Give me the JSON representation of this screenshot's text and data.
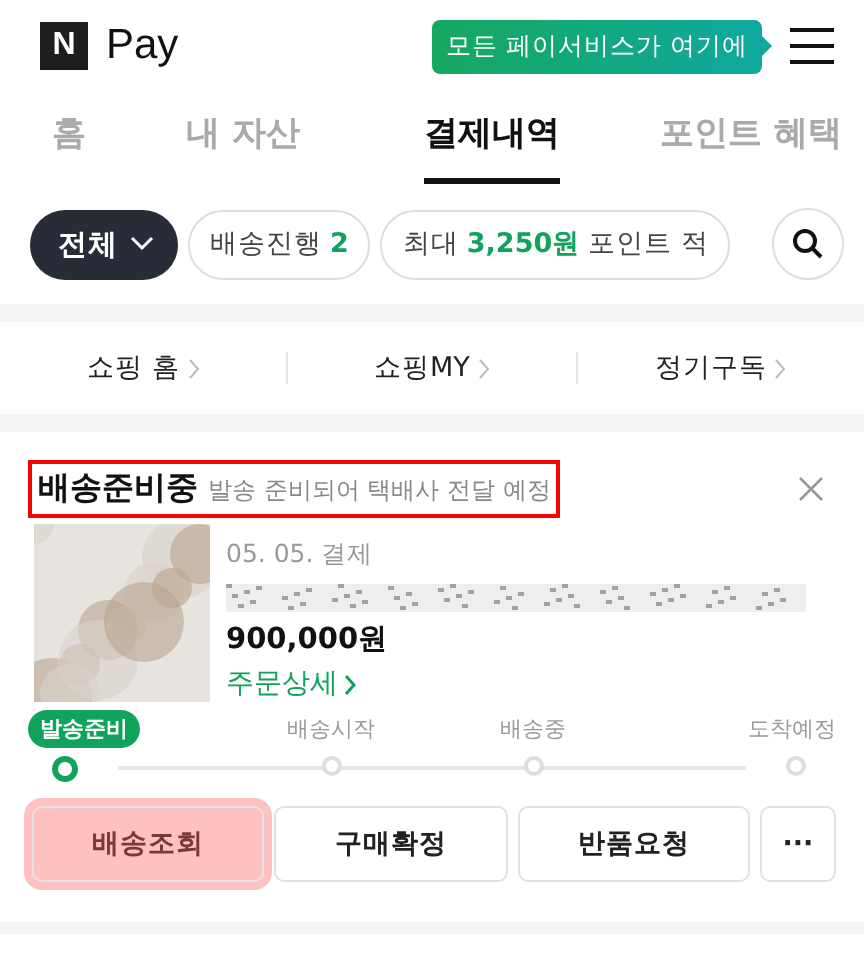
{
  "header": {
    "logo_mark": "N",
    "logo_text": "Pay",
    "tooltip": "모든 페이서비스가 여기에"
  },
  "tabs": [
    {
      "label": "홈",
      "selected": false
    },
    {
      "label": "내 자산",
      "selected": false
    },
    {
      "label": "결제내역",
      "selected": true
    },
    {
      "label": "포인트 혜택",
      "selected": false
    }
  ],
  "filters": {
    "dropdown": "전체",
    "chips": [
      {
        "label": "배송진행",
        "count": "2"
      },
      {
        "label": "최대",
        "highlight": "3,250원",
        "rest": "포인트 적"
      }
    ]
  },
  "shortcuts": [
    {
      "label": "쇼핑 홈"
    },
    {
      "label": "쇼핑MY"
    },
    {
      "label": "정기구독"
    }
  ],
  "order": {
    "status": "배송준비중",
    "status_note": "발송 준비되어 택배사 전달 예정",
    "outlined": true,
    "date": "05. 05. 결제",
    "price": "900,000원",
    "detail_link": "주문상세",
    "steps": [
      {
        "label": "발송준비",
        "selected": true
      },
      {
        "label": "배송시작",
        "selected": false
      },
      {
        "label": "배송중",
        "selected": false
      },
      {
        "label": "도착예정",
        "selected": false
      }
    ],
    "buttons": [
      {
        "label": "배송조회",
        "highlighted": true
      },
      {
        "label": "구매확정",
        "highlighted": false
      },
      {
        "label": "반품요청",
        "highlighted": false
      },
      {
        "label": "···",
        "highlighted": false
      }
    ]
  }
}
